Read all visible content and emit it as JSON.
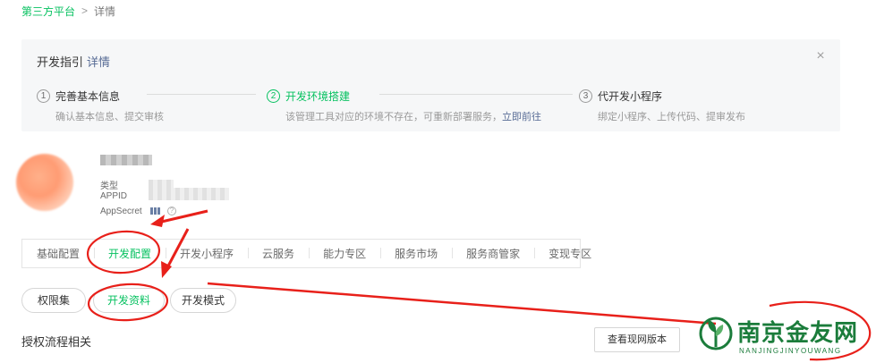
{
  "breadcrumb": {
    "parent": "第三方平台",
    "separator": ">",
    "current": "详情"
  },
  "guide": {
    "title": "开发指引",
    "title_link": "详情",
    "close_glyph": "×",
    "steps": [
      {
        "num": "1",
        "title": "完善基本信息",
        "desc": "确认基本信息、提交审核",
        "desc_link": ""
      },
      {
        "num": "2",
        "title": "开发环境搭建",
        "desc": "该管理工具对应的环境不存在，可重新部署服务，",
        "desc_link": "立即前往"
      },
      {
        "num": "3",
        "title": "代开发小程序",
        "desc": "绑定小程序、上传代码、提审发布",
        "desc_link": ""
      }
    ],
    "active_step": 2
  },
  "account": {
    "type_label": "类型",
    "appid_label": "APPID",
    "secret_label": "AppSecret",
    "help_glyph": "?"
  },
  "tabs": [
    {
      "label": "基础配置"
    },
    {
      "label": "开发配置"
    },
    {
      "label": "开发小程序"
    },
    {
      "label": "云服务"
    },
    {
      "label": "能力专区"
    },
    {
      "label": "服务市场"
    },
    {
      "label": "服务商管家"
    },
    {
      "label": "变现专区"
    }
  ],
  "active_tab": 1,
  "subtabs": [
    {
      "label": "权限集"
    },
    {
      "label": "开发资料"
    },
    {
      "label": "开发模式"
    }
  ],
  "active_subtab": 1,
  "section": {
    "title": "授权流程相关",
    "button": "查看现网版本"
  },
  "watermark": {
    "name": "南京金友网",
    "pinyin": "NANJINGJINYOUWANG"
  },
  "colors": {
    "accent": "#07c160",
    "link": "#576b95",
    "annotation": "#e8201a",
    "logo": "#1b7c3b"
  }
}
